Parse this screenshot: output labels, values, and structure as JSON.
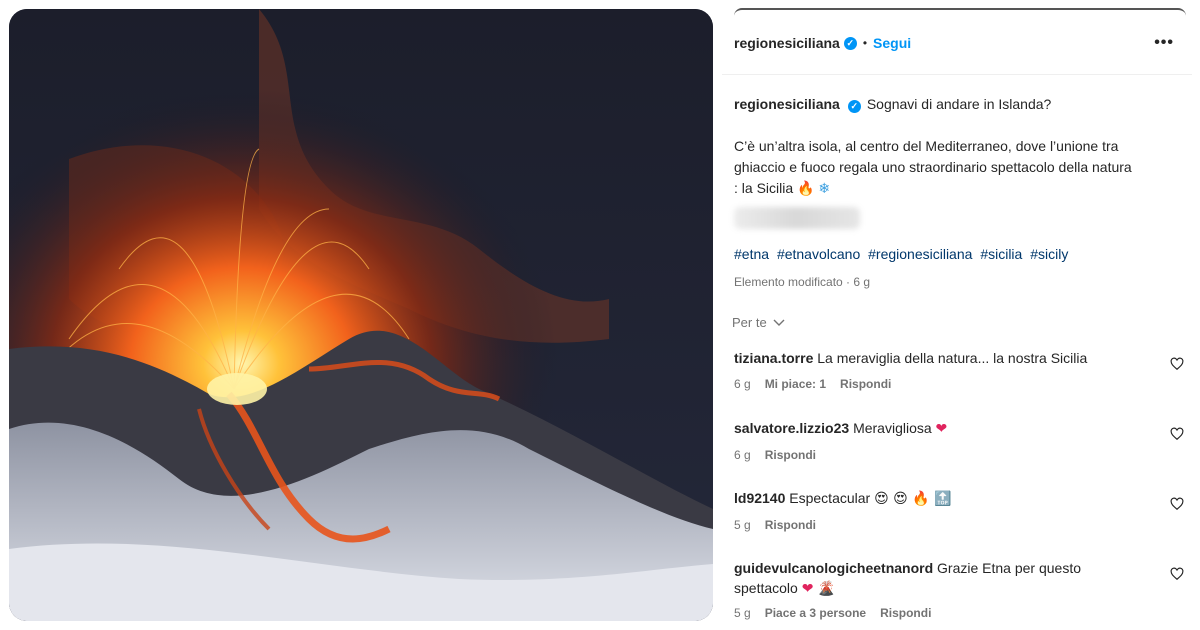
{
  "header": {
    "username": "regionesiciliana",
    "separator": "•",
    "follow_label": "Segui",
    "more_label": "•••"
  },
  "caption": {
    "username": "regionesiciliana",
    "line1": "Sognavi di andare in Islanda?",
    "line2": "C’è un’altra isola, al centro del Mediterraneo, dove l’unione tra",
    "line3": "ghiaccio e fuoco regala uno straordinario spettacolo della natura",
    "line4": ": la Sicilia",
    "emoji_fire": "🔥",
    "emoji_snow": "❄"
  },
  "hashtags": [
    "#etna",
    "#etnavolcano",
    "#regionesiciliana",
    "#sicilia",
    "#sicily"
  ],
  "edited_text": "Elemento modificato · 6 g",
  "lang_label": "Per te",
  "comments": [
    {
      "user": "tiziana.torre",
      "text": "La meraviglia della natura... la nostra Sicilia",
      "time": "6 g",
      "likes": "Mi piace: 1",
      "reply": "Rispondi"
    },
    {
      "user": "salvatore.lizzio23",
      "text": "Meravigliosa",
      "emoji": "❤",
      "time": "6 g",
      "reply": "Rispondi"
    },
    {
      "user": "ld92140",
      "text": "Espectacular",
      "emoji": "😍 😍 🔥 🔝",
      "time": "5 g",
      "reply": "Rispondi"
    },
    {
      "user": "guidevulcanologicheetnanord",
      "text": "Grazie Etna per questo",
      "text2": "spettacolo",
      "emoji": "❤ 🌋",
      "time": "5 g",
      "likes": "Piace a 3 persone",
      "reply": "Rispondi"
    }
  ]
}
